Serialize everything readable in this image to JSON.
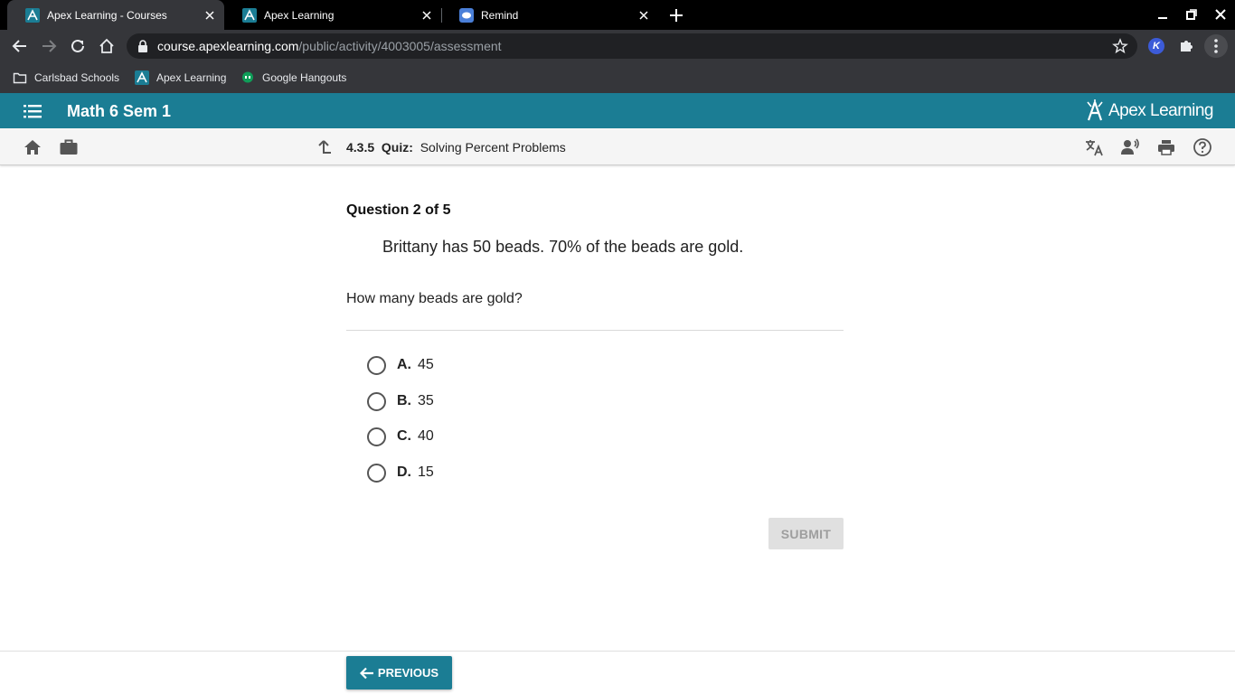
{
  "browser": {
    "tabs": [
      {
        "title": "Apex Learning - Courses",
        "active": true
      },
      {
        "title": "Apex Learning",
        "active": false
      },
      {
        "title": "Remind",
        "active": false
      }
    ],
    "url_host": "course.apexlearning.com",
    "url_path": "/public/activity/4003005/assessment",
    "bookmarks": [
      "Carlsbad Schools",
      "Apex Learning",
      "Google Hangouts"
    ],
    "extension_letter": "K"
  },
  "app": {
    "course_title": "Math 6 Sem 1",
    "brand": "Apex Learning",
    "brand_color": "#1b7d94"
  },
  "activity": {
    "number": "4.3.5",
    "type": "Quiz:",
    "title": "Solving Percent Problems"
  },
  "question": {
    "counter": "Question 2 of 5",
    "stem": "Brittany has 50 beads. 70% of the beads are gold.",
    "prompt": "How many beads are gold?",
    "choices": [
      {
        "letter": "A.",
        "value": "45"
      },
      {
        "letter": "B.",
        "value": "35"
      },
      {
        "letter": "C.",
        "value": "40"
      },
      {
        "letter": "D.",
        "value": "15"
      }
    ],
    "submit_label": "SUBMIT"
  },
  "footer": {
    "previous_label": "PREVIOUS"
  }
}
